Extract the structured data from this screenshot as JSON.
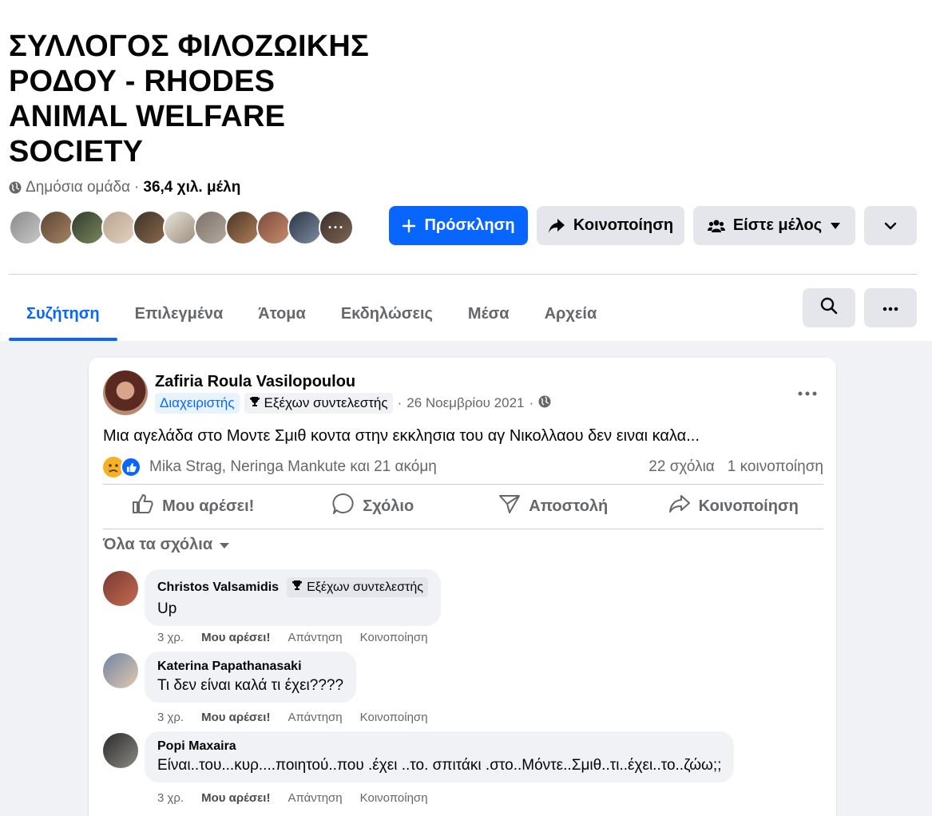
{
  "group": {
    "title": "ΣΥΛΛΟΓΟΣ ΦΙΛΟΖΩΙΚΗΣ ΡΟΔΟΥ - RHODES ANIMAL WELFARE SOCIETY",
    "privacy": "Δημόσια ομάδα",
    "separator": "·",
    "members": "36,4 χιλ. μέλη",
    "more_members_glyph": "···"
  },
  "buttons": {
    "invite": "Πρόσκληση",
    "share": "Κοινοποίηση",
    "member": "Είστε μέλος"
  },
  "tabs": [
    "Συζήτηση",
    "Επιλεγμένα",
    "Άτομα",
    "Εκδηλώσεις",
    "Μέσα",
    "Αρχεία"
  ],
  "post": {
    "author": "Zafiria Roula Vasilopoulou",
    "role_badge": "Διαχειριστής",
    "contributor_badge": "Εξέχων συντελεστής",
    "date": "26 Νοεμβρίου 2021",
    "text": "Μια αγελάδα στο Μοντε Σμιθ κοντα στην εκκλησια του αγ Νικολλαου δεν ειναι καλα...",
    "reactors": "Mika Strag, Neringa Mankute και 21 ακόμη",
    "comments_count": "22 σχόλια",
    "shares_count": "1 κοινοποίηση",
    "actions": {
      "like": "Μου αρέσει!",
      "comment": "Σχόλιο",
      "send": "Αποστολή",
      "share": "Κοινοποίηση"
    },
    "sort_label": "Όλα τα σχόλια"
  },
  "comments": [
    {
      "author": "Christos Valsamidis",
      "badge": "Εξέχων συντελεστής",
      "text": "Up",
      "time": "3 χρ.",
      "like": "Μου αρέσει!",
      "reply": "Απάντηση",
      "share": "Κοινοποίηση"
    },
    {
      "author": "Katerina Papathanasaki",
      "text": "Τι δεν είναι καλά τι έχει????",
      "time": "3 χρ.",
      "like": "Μου αρέσει!",
      "reply": "Απάντηση",
      "share": "Κοινοποίηση"
    },
    {
      "author": "Popi Maxaira",
      "text": "Είναι..του...κυρ....ποιητού..που .έχει ..το. σπιτάκι .στο..Μόντε..Σμιθ..τι..έχει..το..ζώω;;",
      "time": "3 χρ.",
      "like": "Μου αρέσει!",
      "reply": "Απάντηση",
      "share": "Κοινοποίηση"
    }
  ],
  "colors": {
    "accent": "#0866ff",
    "button_grey": "#e4e6eb",
    "page_bg": "#f0f2f5",
    "secondary_text": "#65676b"
  },
  "icons": {
    "privacy": "globe-icon",
    "invite": "plus-icon",
    "share": "share-arrow-icon",
    "member": "people-icon",
    "dropdown": "caret-down-icon",
    "search": "search-icon",
    "more": "more-icon",
    "trophy": "trophy-icon",
    "like": "thumbs-up-icon",
    "comment": "comment-icon",
    "send": "send-icon"
  }
}
